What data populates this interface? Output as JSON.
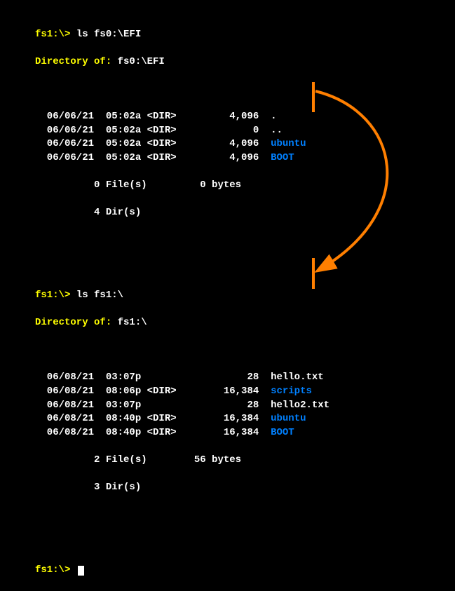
{
  "block1": {
    "prompt": "fs1:\\>",
    "cmd": " ls fs0:\\EFI",
    "dirlabel": "Directory of:",
    "dirpath": " fs0:\\EFI",
    "rows": [
      {
        "date": "06/06/21",
        "time": "05:02a",
        "tag": "<DIR>",
        "size": "4,096",
        "name": ".",
        "color": "white"
      },
      {
        "date": "06/06/21",
        "time": "05:02a",
        "tag": "<DIR>",
        "size": "0",
        "name": "..",
        "color": "white"
      },
      {
        "date": "06/06/21",
        "time": "05:02a",
        "tag": "<DIR>",
        "size": "4,096",
        "name": "ubuntu",
        "color": "blue"
      },
      {
        "date": "06/06/21",
        "time": "05:02a",
        "tag": "<DIR>",
        "size": "4,096",
        "name": "BOOT",
        "color": "blue"
      }
    ],
    "summary1": "          0 File(s)         0 bytes",
    "summary2": "          4 Dir(s)"
  },
  "block2": {
    "prompt": "fs1:\\>",
    "cmd": " ls fs1:\\",
    "dirlabel": "Directory of:",
    "dirpath": " fs1:\\",
    "rows": [
      {
        "date": "06/08/21",
        "time": "03:07p",
        "tag": "     ",
        "size": "28",
        "name": "hello.txt",
        "color": "white"
      },
      {
        "date": "06/08/21",
        "time": "08:06p",
        "tag": "<DIR>",
        "size": "16,384",
        "name": "scripts",
        "color": "blue"
      },
      {
        "date": "06/08/21",
        "time": "03:07p",
        "tag": "     ",
        "size": "28",
        "name": "hello2.txt",
        "color": "white"
      },
      {
        "date": "06/08/21",
        "time": "08:40p",
        "tag": "<DIR>",
        "size": "16,384",
        "name": "ubuntu",
        "color": "blue"
      },
      {
        "date": "06/08/21",
        "time": "08:40p",
        "tag": "<DIR>",
        "size": "16,384",
        "name": "BOOT",
        "color": "blue"
      }
    ],
    "summary1": "          2 File(s)        56 bytes",
    "summary2": "          3 Dir(s)"
  },
  "final_prompt": "fs1:\\> "
}
